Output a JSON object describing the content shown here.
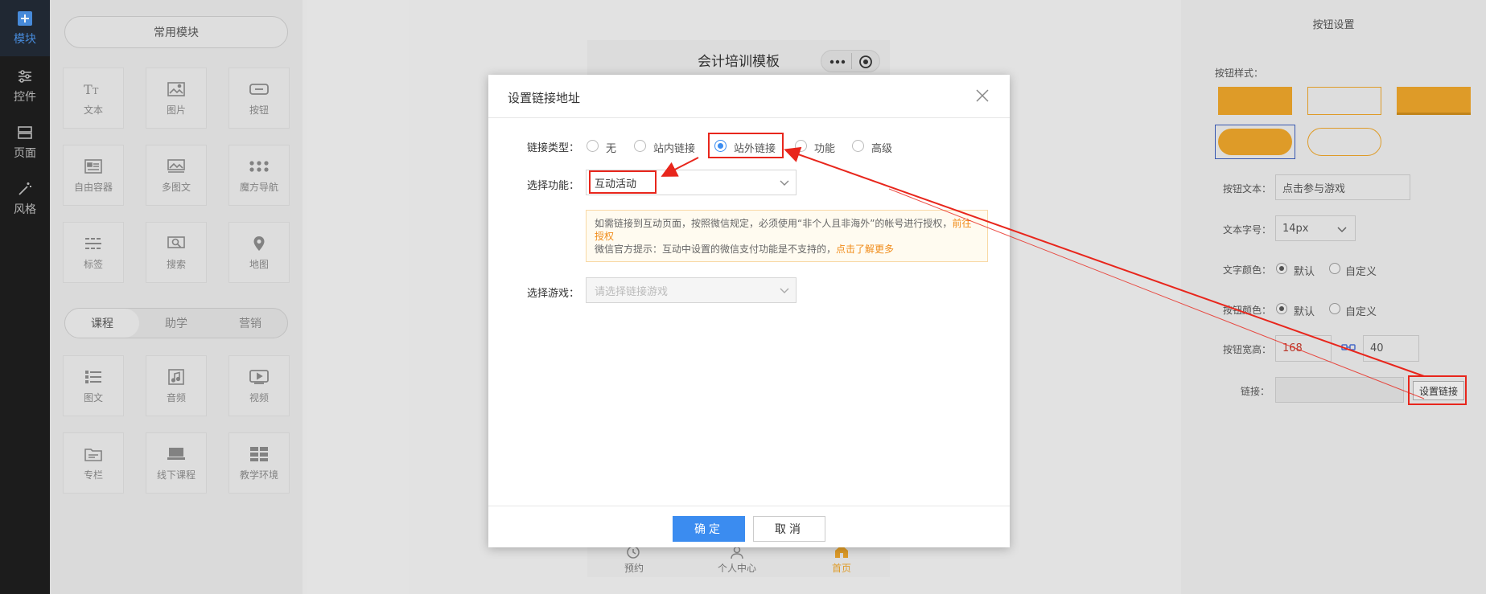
{
  "rail": {
    "items": [
      {
        "label": "模块",
        "icon": "plus-square-icon",
        "active": true
      },
      {
        "label": "控件",
        "icon": "sliders-icon"
      },
      {
        "label": "页面",
        "icon": "layout-icon"
      },
      {
        "label": "风格",
        "icon": "magic-wand-icon"
      }
    ]
  },
  "modules": {
    "common_label": "常用模块",
    "common": [
      "文本",
      "图片",
      "按钮",
      "自由容器",
      "多图文",
      "魔方导航",
      "标签",
      "搜索",
      "地图"
    ],
    "tabs": [
      "课程",
      "助学",
      "营销"
    ],
    "course": [
      "图文",
      "音频",
      "视频",
      "专栏",
      "线下课程",
      "教学环境"
    ]
  },
  "phone": {
    "title": "会计培训模板",
    "nav": [
      "预约",
      "个人中心",
      "首页"
    ]
  },
  "settings": {
    "header": "按钮设置",
    "style_label": "按钮样式：",
    "text_label": "按钮文本：",
    "text_value": "点击参与游戏",
    "fontsize_label": "文本字号：",
    "fontsize_value": "14px",
    "textcolor_label": "文字颜色：",
    "btncolor_label": "按钮颜色：",
    "opt_default": "默认",
    "opt_custom": "自定义",
    "size_label": "按钮宽高：",
    "width": "168",
    "height": "40",
    "link_label": "链接：",
    "link_button": "设置链接",
    "accent": "#e8a22a"
  },
  "dialog": {
    "title": "设置链接地址",
    "type_label": "链接类型：",
    "types": [
      "无",
      "站内链接",
      "站外链接",
      "功能",
      "高级"
    ],
    "selected_type": "站外链接",
    "func_label": "选择功能：",
    "func_value": "互动活动",
    "notice_line1": "如需链接到互动页面，按照微信规定，必须使用“非个人且非海外”的帐号进行授权，",
    "notice_link1": "前往授权",
    "notice_line2": "微信官方提示：互动中设置的微信支付功能是不支持的，",
    "notice_link2": "点击了解更多",
    "game_label": "选择游戏：",
    "game_placeholder": "请选择链接游戏",
    "ok": "确定",
    "cancel": "取消",
    "primary_color": "#3b8cf0"
  }
}
